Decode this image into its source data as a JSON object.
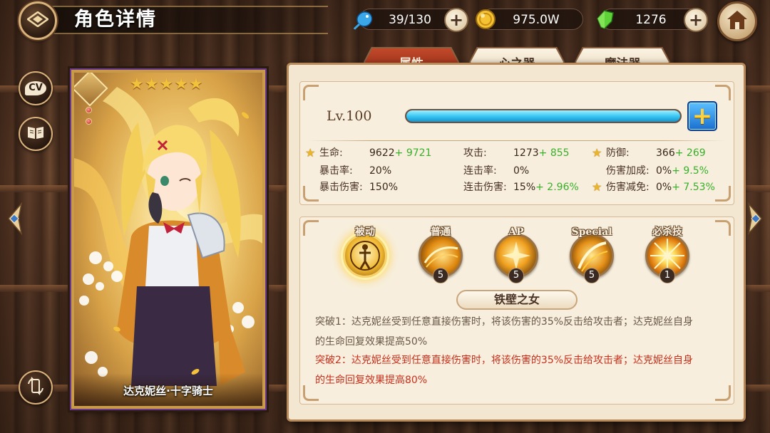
{
  "header": {
    "title": "角色详情",
    "resources": [
      {
        "icon": "blue-creature-icon",
        "value": "39/130"
      },
      {
        "icon": "gold-coin-icon",
        "value": "975.0W"
      },
      {
        "icon": "green-crystal-icon",
        "value": "1276"
      }
    ]
  },
  "side_buttons": {
    "cv_label": "CV"
  },
  "card": {
    "name": "达克妮丝·十字骑士",
    "stars": 5
  },
  "tabs": [
    {
      "label": "属性",
      "active": true
    },
    {
      "label": "心之器",
      "active": false
    },
    {
      "label": "魔法器",
      "active": false
    }
  ],
  "level": {
    "label": "Lv.100",
    "progress": 1.0
  },
  "stats": [
    {
      "label": "生命:",
      "value": "9622",
      "bonus": "+ 9721",
      "starred": true
    },
    {
      "label": "攻击:",
      "value": "1273",
      "bonus": "+ 855",
      "starred": false
    },
    {
      "label": "防御:",
      "value": "366",
      "bonus": "+ 269",
      "starred": true
    },
    {
      "label": "暴击率:",
      "value": "20%",
      "bonus": "",
      "starred": false
    },
    {
      "label": "连击率:",
      "value": "0%",
      "bonus": "",
      "starred": false
    },
    {
      "label": "伤害加成:",
      "value": "0%",
      "bonus": "+ 9.5%",
      "starred": false
    },
    {
      "label": "暴击伤害:",
      "value": "150%",
      "bonus": "",
      "starred": false
    },
    {
      "label": "连击伤害:",
      "value": "15%",
      "bonus": "+ 2.96%",
      "starred": false
    },
    {
      "label": "伤害减免:",
      "value": "0%",
      "bonus": "+ 7.53%",
      "starred": true
    }
  ],
  "skills": [
    {
      "name": "被动",
      "level": "",
      "selected": true
    },
    {
      "name": "普通",
      "level": "5",
      "selected": false
    },
    {
      "name": "AP",
      "level": "5",
      "selected": false
    },
    {
      "name": "Special",
      "level": "5",
      "selected": false
    },
    {
      "name": "必杀技",
      "level": "1",
      "selected": false
    }
  ],
  "skill_detail": {
    "title": "铁壁之女",
    "breakthrough1_line1": "突破1：达克妮丝受到任意直接伤害时，将该伤害的35%反击给攻击者；达克妮丝自身",
    "breakthrough1_line2": "的生命回复效果提高50%",
    "breakthrough2_line1": "突破2：达克妮丝受到任意直接伤害时，将该伤害的35%反击给攻击者；达克妮丝自身",
    "breakthrough2_line2": "的生命回复效果提高80%"
  },
  "colors": {
    "accent_red": "#c8301c",
    "bonus_green": "#38b02a",
    "panel_bg": "#f3e7d2",
    "level_bar": "#34c3f2"
  }
}
